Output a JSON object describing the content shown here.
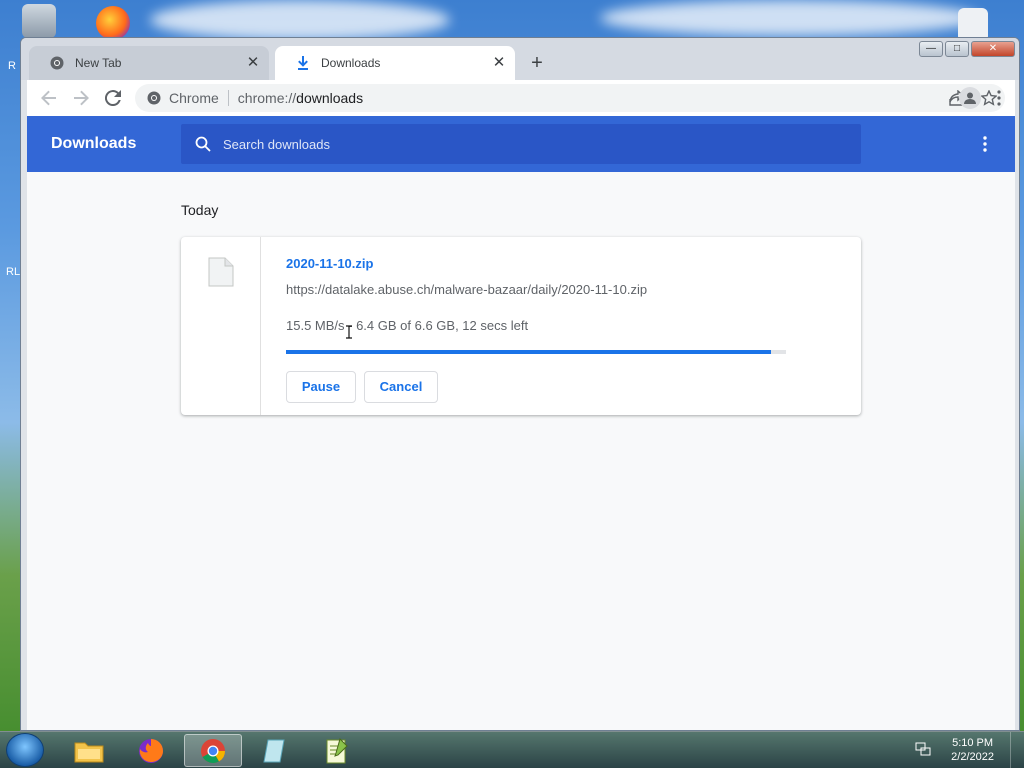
{
  "desktop": {
    "left_fragments": [
      "R",
      "RL"
    ]
  },
  "window": {
    "tabs": [
      {
        "label": "New Tab",
        "active": false,
        "icon": "chrome-icon"
      },
      {
        "label": "Downloads",
        "active": true,
        "icon": "download-icon"
      }
    ],
    "controls": {
      "minimize": "—",
      "maximize": "□",
      "close": "✕"
    }
  },
  "toolbar": {
    "omnibox": {
      "chip": "Chrome",
      "scheme": "chrome://",
      "path": "downloads"
    }
  },
  "downloads_page": {
    "title": "Downloads",
    "search_placeholder": "Search downloads",
    "section_label": "Today",
    "item": {
      "file_name": "2020-11-10.zip",
      "url": "https://datalake.abuse.ch/malware-bazaar/daily/2020-11-10.zip",
      "status": "15.5 MB/s - 6.4 GB of 6.6 GB, 12 secs left",
      "progress_percent": 97,
      "pause_label": "Pause",
      "cancel_label": "Cancel"
    }
  },
  "taskbar": {
    "time": "5:10 PM",
    "date": "2/2/2022",
    "apps": [
      "file-explorer-icon",
      "firefox-icon",
      "chrome-icon",
      "notes-icon",
      "notepad-plus-plus-icon"
    ]
  },
  "colors": {
    "header_blue": "#3367d6",
    "accent_blue": "#1a73e8",
    "search_bg": "#2a56c6"
  }
}
